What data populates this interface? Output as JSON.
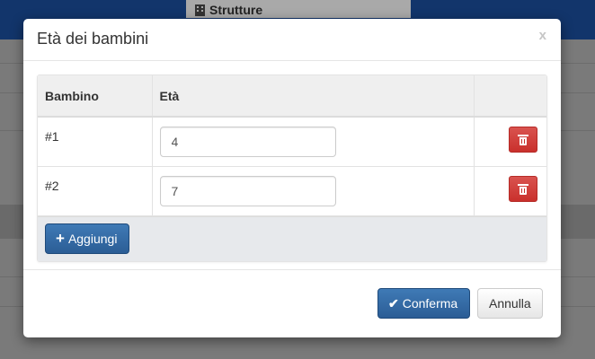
{
  "background": {
    "tab_label": "Strutture",
    "tab_icon": "building-icon"
  },
  "modal": {
    "title": "Età dei bambini",
    "close_label": "x",
    "table": {
      "headers": [
        "Bambino",
        "Età",
        ""
      ],
      "rows": [
        {
          "label": "#1",
          "age": "4"
        },
        {
          "label": "#2",
          "age": "7"
        }
      ]
    },
    "add_label": "Aggiungi",
    "confirm_label": "Conferma",
    "cancel_label": "Annulla"
  },
  "colors": {
    "primary": "#2b5d95",
    "danger": "#d9534f",
    "topbar": "#12356b"
  }
}
